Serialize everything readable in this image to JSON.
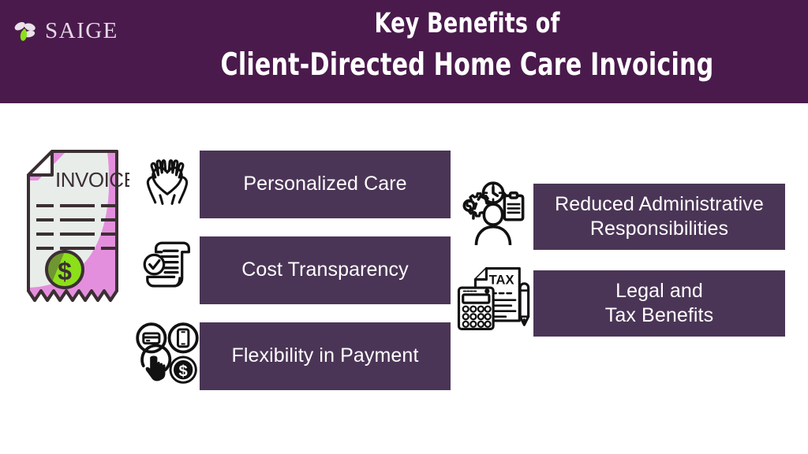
{
  "header": {
    "background_color": "#4a1a4c",
    "logo": {
      "name": "saige-logo",
      "wordmark": "SAIGE",
      "petal_color_light": "#e9e2ea",
      "petal_color_green": "#8ce019"
    },
    "title_line_1": "Key Benefits of",
    "title_line_2": "Client-Directed Home Care Invoicing"
  },
  "theme": {
    "box_fill": "#4b3556",
    "box_text": "#ffffff",
    "page_background": "#ffffff",
    "accent_pink": "#e48fdd",
    "accent_green": "#8ce019",
    "paper": "#e8edea",
    "ink": "#3b2f33"
  },
  "invoice": {
    "name": "invoice-illustration",
    "heading": "INVOICE",
    "line_rows": 4,
    "line_segments_per_row": 3,
    "coin_symbol": "$"
  },
  "benefits": [
    {
      "id": "personalized-care",
      "icon": "hands-holding-heart-icon",
      "lines": [
        "Personalized Care"
      ],
      "column": "left"
    },
    {
      "id": "cost-transparency",
      "icon": "scroll-checkmark-icon",
      "lines": [
        "Cost Transparency"
      ],
      "column": "left"
    },
    {
      "id": "flexibility-in-payment",
      "icon": "payment-methods-icon",
      "lines": [
        "Flexibility in Payment"
      ],
      "column": "left"
    },
    {
      "id": "reduced-administrative-responsibilities",
      "icon": "admin-person-clock-gear-clipboard-icon",
      "lines": [
        "Reduced Administrative",
        "Responsibilities"
      ],
      "column": "right"
    },
    {
      "id": "legal-and-tax-benefits",
      "icon": "tax-document-calculator-pen-icon",
      "lines": [
        "Legal and",
        "Tax Benefits"
      ],
      "column": "right"
    }
  ]
}
